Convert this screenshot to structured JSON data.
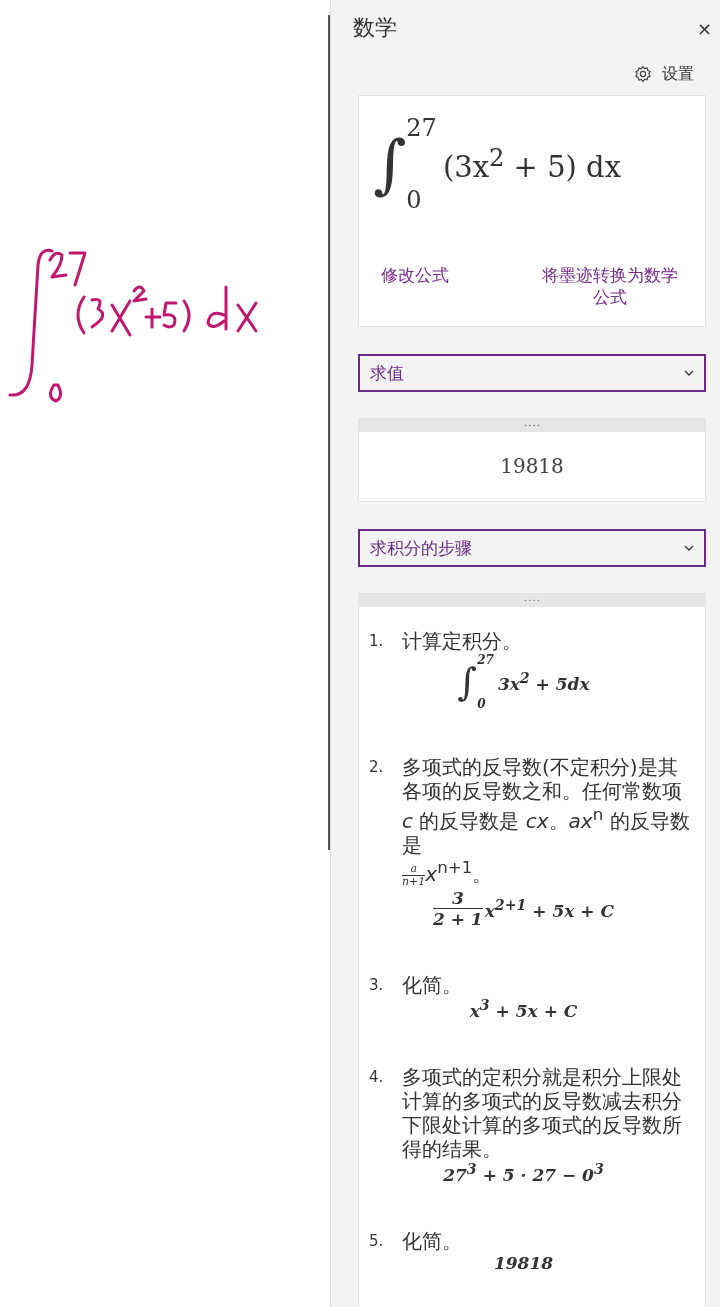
{
  "pane": {
    "title": "数学",
    "close": "×",
    "settings": "设置"
  },
  "formula_card": {
    "sign": "∫",
    "upper": "27",
    "lower": "0",
    "body": "(3x$^{2}$ + 5) dx",
    "edit_link": "修改公式",
    "convert_link": "将墨迹转换为数学公式"
  },
  "action_dropdown": {
    "value": "求值"
  },
  "result": {
    "value": "19818"
  },
  "steps_dropdown": {
    "value": "求积分的步骤"
  },
  "steps": [
    {
      "number": "1.",
      "text": "计算定积分。",
      "math": {
        "kind": "integral",
        "sign": "∫",
        "upper": "27",
        "lower": "0",
        "body": "3x$^{2}$ + 5dx"
      }
    },
    {
      "number": "2.",
      "text": "多项式的反导数(不定积分)是其各项的反导数之和。任何常数项 *c* 的反导数是 *cx*。*ax*$^{n}$ 的反导数是",
      "inline_fraction": {
        "num": "a",
        "den": "n+1",
        "after": "*x*$^{n+1}$。"
      },
      "math": {
        "kind": "fraction",
        "num": "3",
        "den": "2 + 1",
        "body": "x$^{2+1}$ + 5x + C"
      }
    },
    {
      "number": "3.",
      "text": "化简。",
      "math": {
        "kind": "expression",
        "body": "x$^{3}$ + 5x + C"
      }
    },
    {
      "number": "4.",
      "text": "多项式的定积分就是积分上限处计算的多项式的反导数减去积分下限处计算的多项式的反导数所得的结果。",
      "math": {
        "kind": "expression",
        "body": "27$^{3}$ + 5 · 27 − 0$^{3}$"
      }
    },
    {
      "number": "5.",
      "text": "化简。",
      "math": {
        "kind": "expression",
        "body": "19818"
      }
    }
  ]
}
